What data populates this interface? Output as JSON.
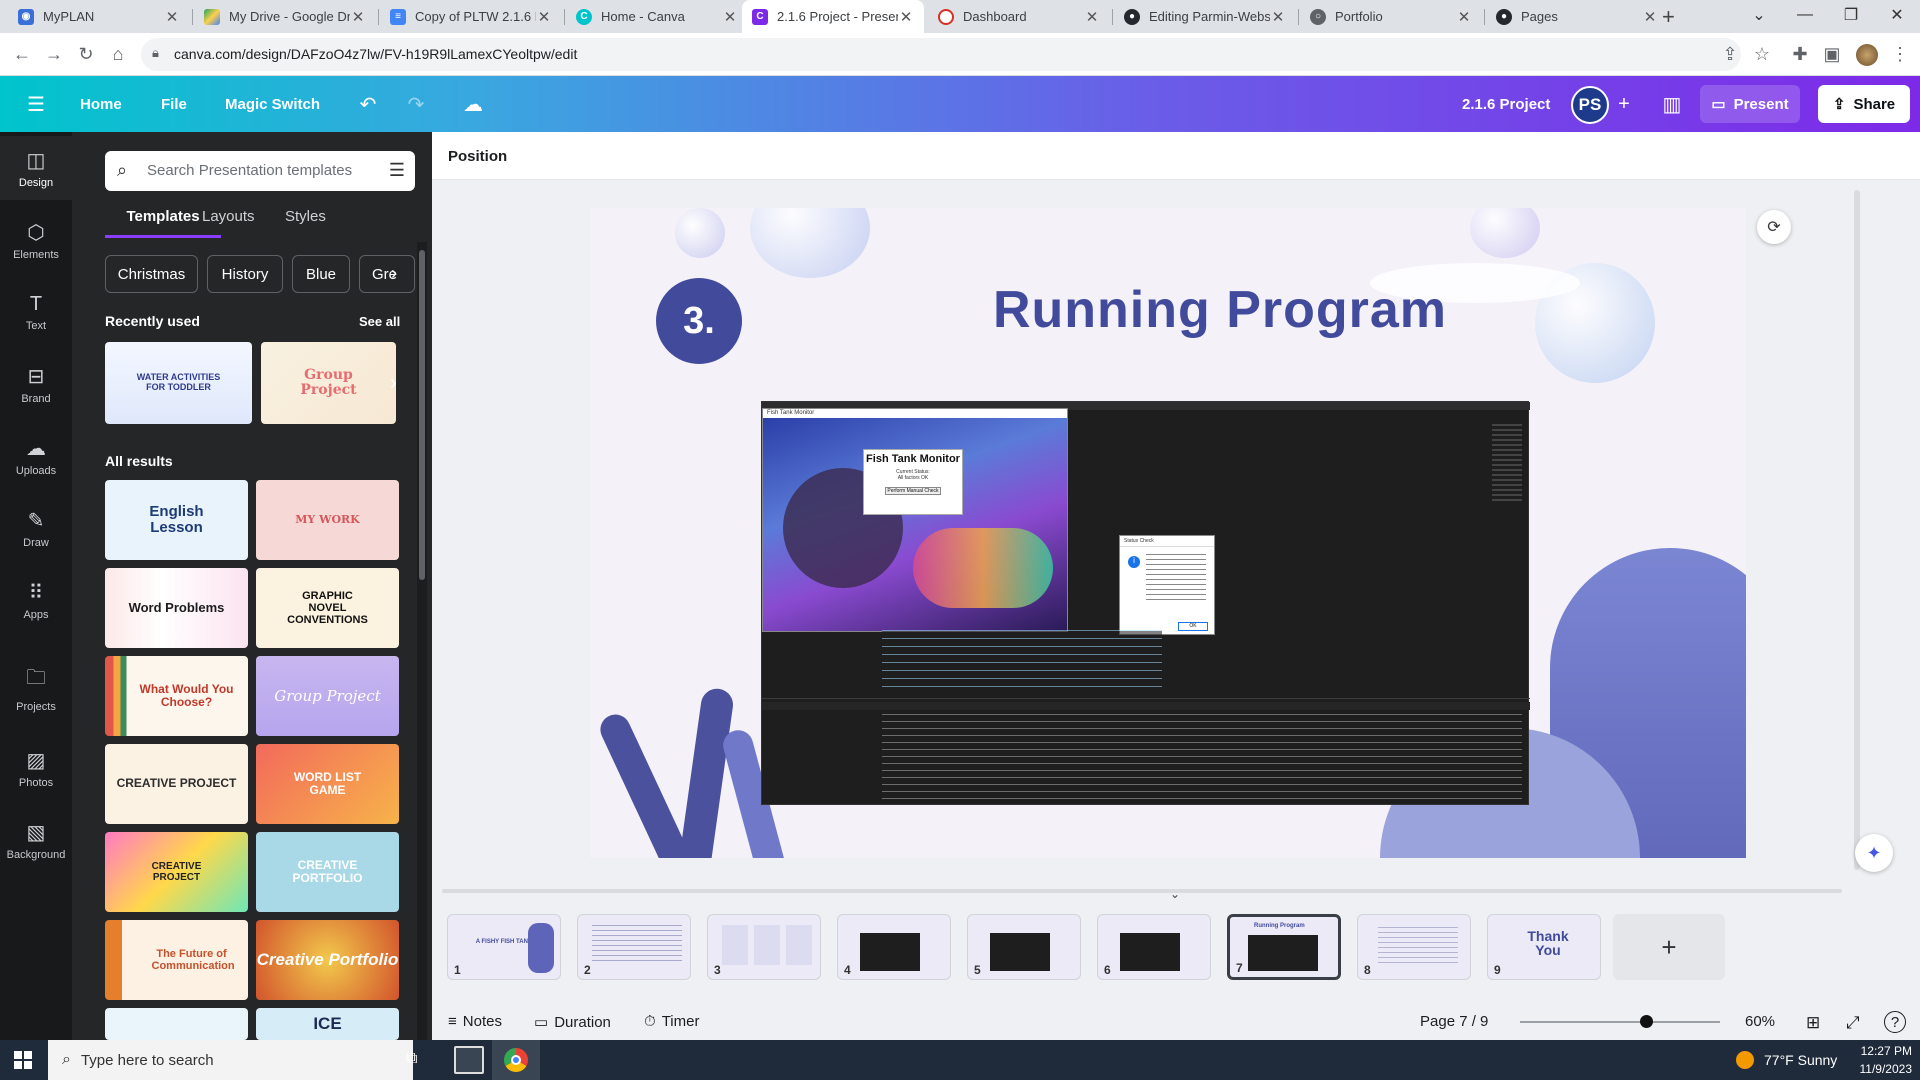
{
  "browser": {
    "tabs": [
      {
        "title": "MyPLAN",
        "icon": "myplan-icon",
        "color": "#3b6fd8"
      },
      {
        "title": "My Drive - Google Dr",
        "icon": "google-drive-icon",
        "color": "#1fa463"
      },
      {
        "title": "Copy of PLTW 2.1.6 P",
        "icon": "google-docs-icon",
        "color": "#4285f4"
      },
      {
        "title": "Home - Canva",
        "icon": "canva-icon",
        "color": "#00c4cc"
      },
      {
        "title": "2.1.6 Project - Presen",
        "icon": "canva-icon",
        "color": "#7d2ae8"
      },
      {
        "title": "Dashboard",
        "icon": "dashboard-icon",
        "color": "#d93025"
      },
      {
        "title": "Editing Parmin-Webs",
        "icon": "github-icon",
        "color": "#24292f"
      },
      {
        "title": "Portfolio",
        "icon": "globe-icon",
        "color": "#5f6368"
      },
      {
        "title": "Pages",
        "icon": "github-icon",
        "color": "#24292f"
      }
    ],
    "active_tab": 4,
    "new_tab": "+",
    "url": "canva.com/design/DAFzoO4z7lw/FV-h19R9lLamexCYeoltpw/edit"
  },
  "canva_header": {
    "home": "Home",
    "file": "File",
    "magic_switch": "Magic Switch",
    "project_title": "2.1.6 Project",
    "avatar_initials": "PS",
    "present": "Present",
    "share": "Share"
  },
  "rail": {
    "items": [
      "Design",
      "Elements",
      "Text",
      "Brand",
      "Uploads",
      "Draw",
      "Apps",
      "Projects",
      "Photos",
      "Background"
    ]
  },
  "panel": {
    "search_placeholder": "Search Presentation templates",
    "tabs": [
      "Templates",
      "Layouts",
      "Styles"
    ],
    "chips": [
      "Christmas",
      "History",
      "Blue",
      "Gre"
    ],
    "recently_used": "Recently used",
    "see_all": "See all",
    "recent": [
      "WATER ACTIVITIES FOR TODDLER",
      "Group Project"
    ],
    "all_results": "All results",
    "results": [
      "English Lesson",
      "MY WORK",
      "Word Problems",
      "GRAPHIC NOVEL CONVENTIONS",
      "What Would You Choose?",
      "Group Project",
      "CREATIVE PROJECT",
      "WORD LIST GAME",
      "CREATIVE PROJECT",
      "CREATIVE PORTFOLIO",
      "The Future of Communication",
      "Creative Portfolio",
      "",
      "ICE"
    ]
  },
  "toolbar": {
    "position": "Position"
  },
  "slide": {
    "number_badge": "3.",
    "title": "Running Program",
    "window_title": "Fish Tank Monitor",
    "app_heading": "Fish Tank Monitor",
    "status_line1": "Current Status:",
    "status_line2": "All factors OK",
    "check_button": "Perform Manual Check",
    "dialog_title": "Status Check",
    "dialog_ok": "OK"
  },
  "filmstrip": {
    "pages": [
      "1",
      "2",
      "3",
      "4",
      "5",
      "6",
      "7",
      "8",
      "9"
    ],
    "page1_label": "A FISHY FISH TANK",
    "page7_label": "Running Program",
    "page9_label": "Thank You",
    "add": "+"
  },
  "footer": {
    "notes": "Notes",
    "duration": "Duration",
    "timer": "Timer",
    "page_indicator": "Page 7 / 9",
    "zoom": "60%",
    "zoom_level": 0.6
  },
  "taskbar": {
    "search_placeholder": "Type here to search",
    "weather": "77°F  Sunny",
    "time": "12:27 PM",
    "date": "11/9/2023"
  }
}
